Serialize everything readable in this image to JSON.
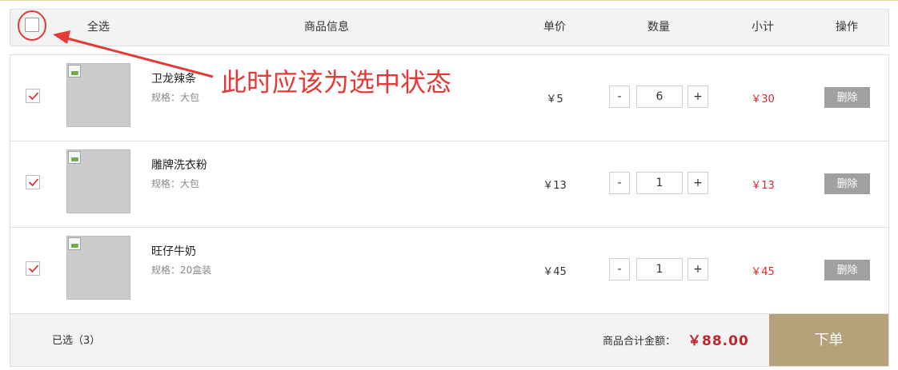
{
  "header": {
    "select_all": "全选",
    "product_info": "商品信息",
    "unit_price": "单价",
    "quantity": "数量",
    "subtotal": "小计",
    "actions": "操作"
  },
  "items": [
    {
      "name": "卫龙辣条",
      "spec": "规格：大包",
      "price": "￥5",
      "quantity": "6",
      "subtotal": "￥30",
      "checked": true,
      "delete_label": "删除"
    },
    {
      "name": "雕牌洗衣粉",
      "spec": "规格：大包",
      "price": "￥13",
      "quantity": "1",
      "subtotal": "￥13",
      "checked": true,
      "delete_label": "删除"
    },
    {
      "name": "旺仔牛奶",
      "spec": "规格：20盒装",
      "price": "￥45",
      "quantity": "1",
      "subtotal": "￥45",
      "checked": true,
      "delete_label": "删除"
    }
  ],
  "qty_minus": "-",
  "qty_plus": "+",
  "footer": {
    "selected_count": "已选（3）",
    "total_label": "商品合计金额：",
    "total_value": "￥88.00",
    "order_label": "下单"
  },
  "annotation": {
    "text": "此时应该为选中状态",
    "color": "#e53935"
  },
  "colors": {
    "accent_red": "#d9232d",
    "order_button": "#b5a17a",
    "delete_button": "#a0a0a0"
  }
}
